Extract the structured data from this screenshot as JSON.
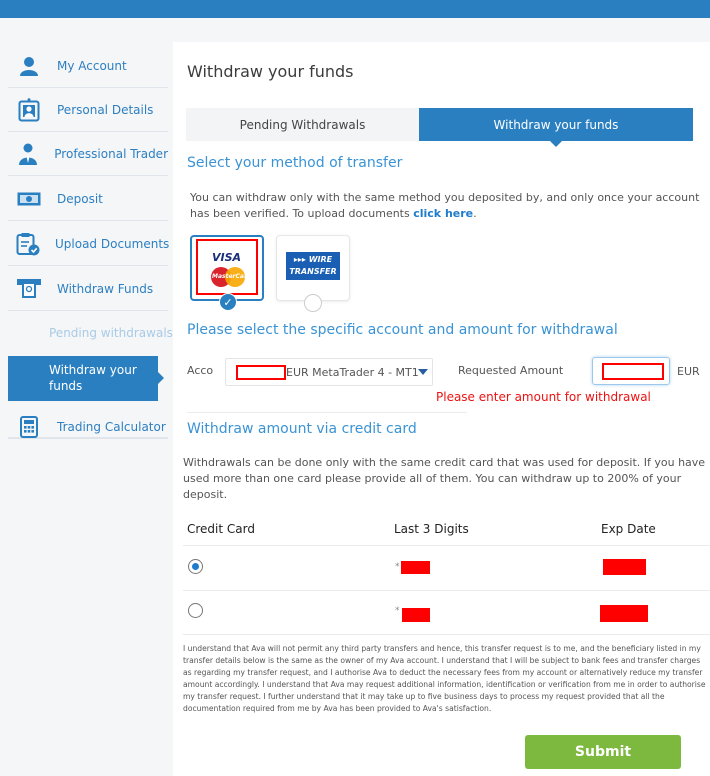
{
  "sidebar": {
    "items": [
      {
        "label": "My Account",
        "icon": "user-icon"
      },
      {
        "label": "Personal Details",
        "icon": "id-badge-icon"
      },
      {
        "label": "Professional Trader",
        "icon": "businessman-icon"
      },
      {
        "label": "Deposit",
        "icon": "banknote-icon"
      },
      {
        "label": "Upload Documents",
        "icon": "clipboard-check-icon"
      },
      {
        "label": "Withdraw Funds",
        "icon": "atm-withdraw-icon"
      }
    ],
    "sub_items": [
      {
        "label": "Pending withdrawals"
      },
      {
        "label": "Withdraw your funds",
        "active": true
      }
    ],
    "calculator": {
      "label": "Trading Calculator",
      "icon": "calculator-icon"
    }
  },
  "main": {
    "title": "Withdraw your funds",
    "tabs": [
      {
        "label": "Pending Withdrawals",
        "active": false
      },
      {
        "label": "Withdraw your funds",
        "active": true
      }
    ],
    "method_heading": "Select your method of transfer",
    "method_text": "You can withdraw only with the same method you deposited by, and only once your account has been verified. To upload documents ",
    "method_link": "click here",
    "method_link_suffix": ".",
    "methods": [
      {
        "name": "VISA / MasterCard",
        "visa": "VISA",
        "mc": "MasterCard",
        "selected": true
      },
      {
        "name": "Wire Transfer",
        "line1": "▸▸▸ WIRE",
        "line2": "TRANSFER",
        "selected": false
      }
    ],
    "account_heading": "Please select the specific account and amount for withdrawal",
    "account_label": "Acco",
    "account_value": "EUR MetaTrader 4 - MT1",
    "amount_label": "Requested Amount",
    "amount_value": "",
    "currency": "EUR",
    "error": "Please enter amount for withdrawal",
    "cc_heading": "Withdraw amount via credit card",
    "cc_text": "Withdrawals can be done only with the same credit card that was used for deposit. If you have used more than one card please provide all of them. You can withdraw up to 200% of your deposit.",
    "table": {
      "headers": [
        "Credit Card",
        "Last 3 Digits",
        "Exp Date"
      ],
      "rows": [
        {
          "selected": true,
          "digits_prefix": "*",
          "digits": "[redacted]",
          "exp": "[redacted]"
        },
        {
          "selected": false,
          "digits_prefix": "*",
          "digits": "[redacted]",
          "exp": "[redacted]"
        }
      ]
    },
    "legal": "I understand that Ava will not permit any third party transfers and hence, this transfer request is to me, and the beneficiary listed in my transfer details below is the same as the owner of my Ava account. I understand that I will be subject to bank fees and transfer charges as regarding my transfer request, and I authorise Ava to deduct the necessary fees from my account or alternatively reduce my transfer amount accordingly. I understand that Ava may request additional information, identification or verification from me in order to authorise my transfer request. I further understand that it may take up to five business days to process my request provided that all the documentation required from me by Ava has been provided to Ava's satisfaction.",
    "submit_label": "Submit"
  },
  "colors": {
    "brand_blue": "#2a7fc1",
    "heading_blue": "#3a93d5",
    "error_red": "#ee1111",
    "submit_green": "#7cb93e"
  }
}
